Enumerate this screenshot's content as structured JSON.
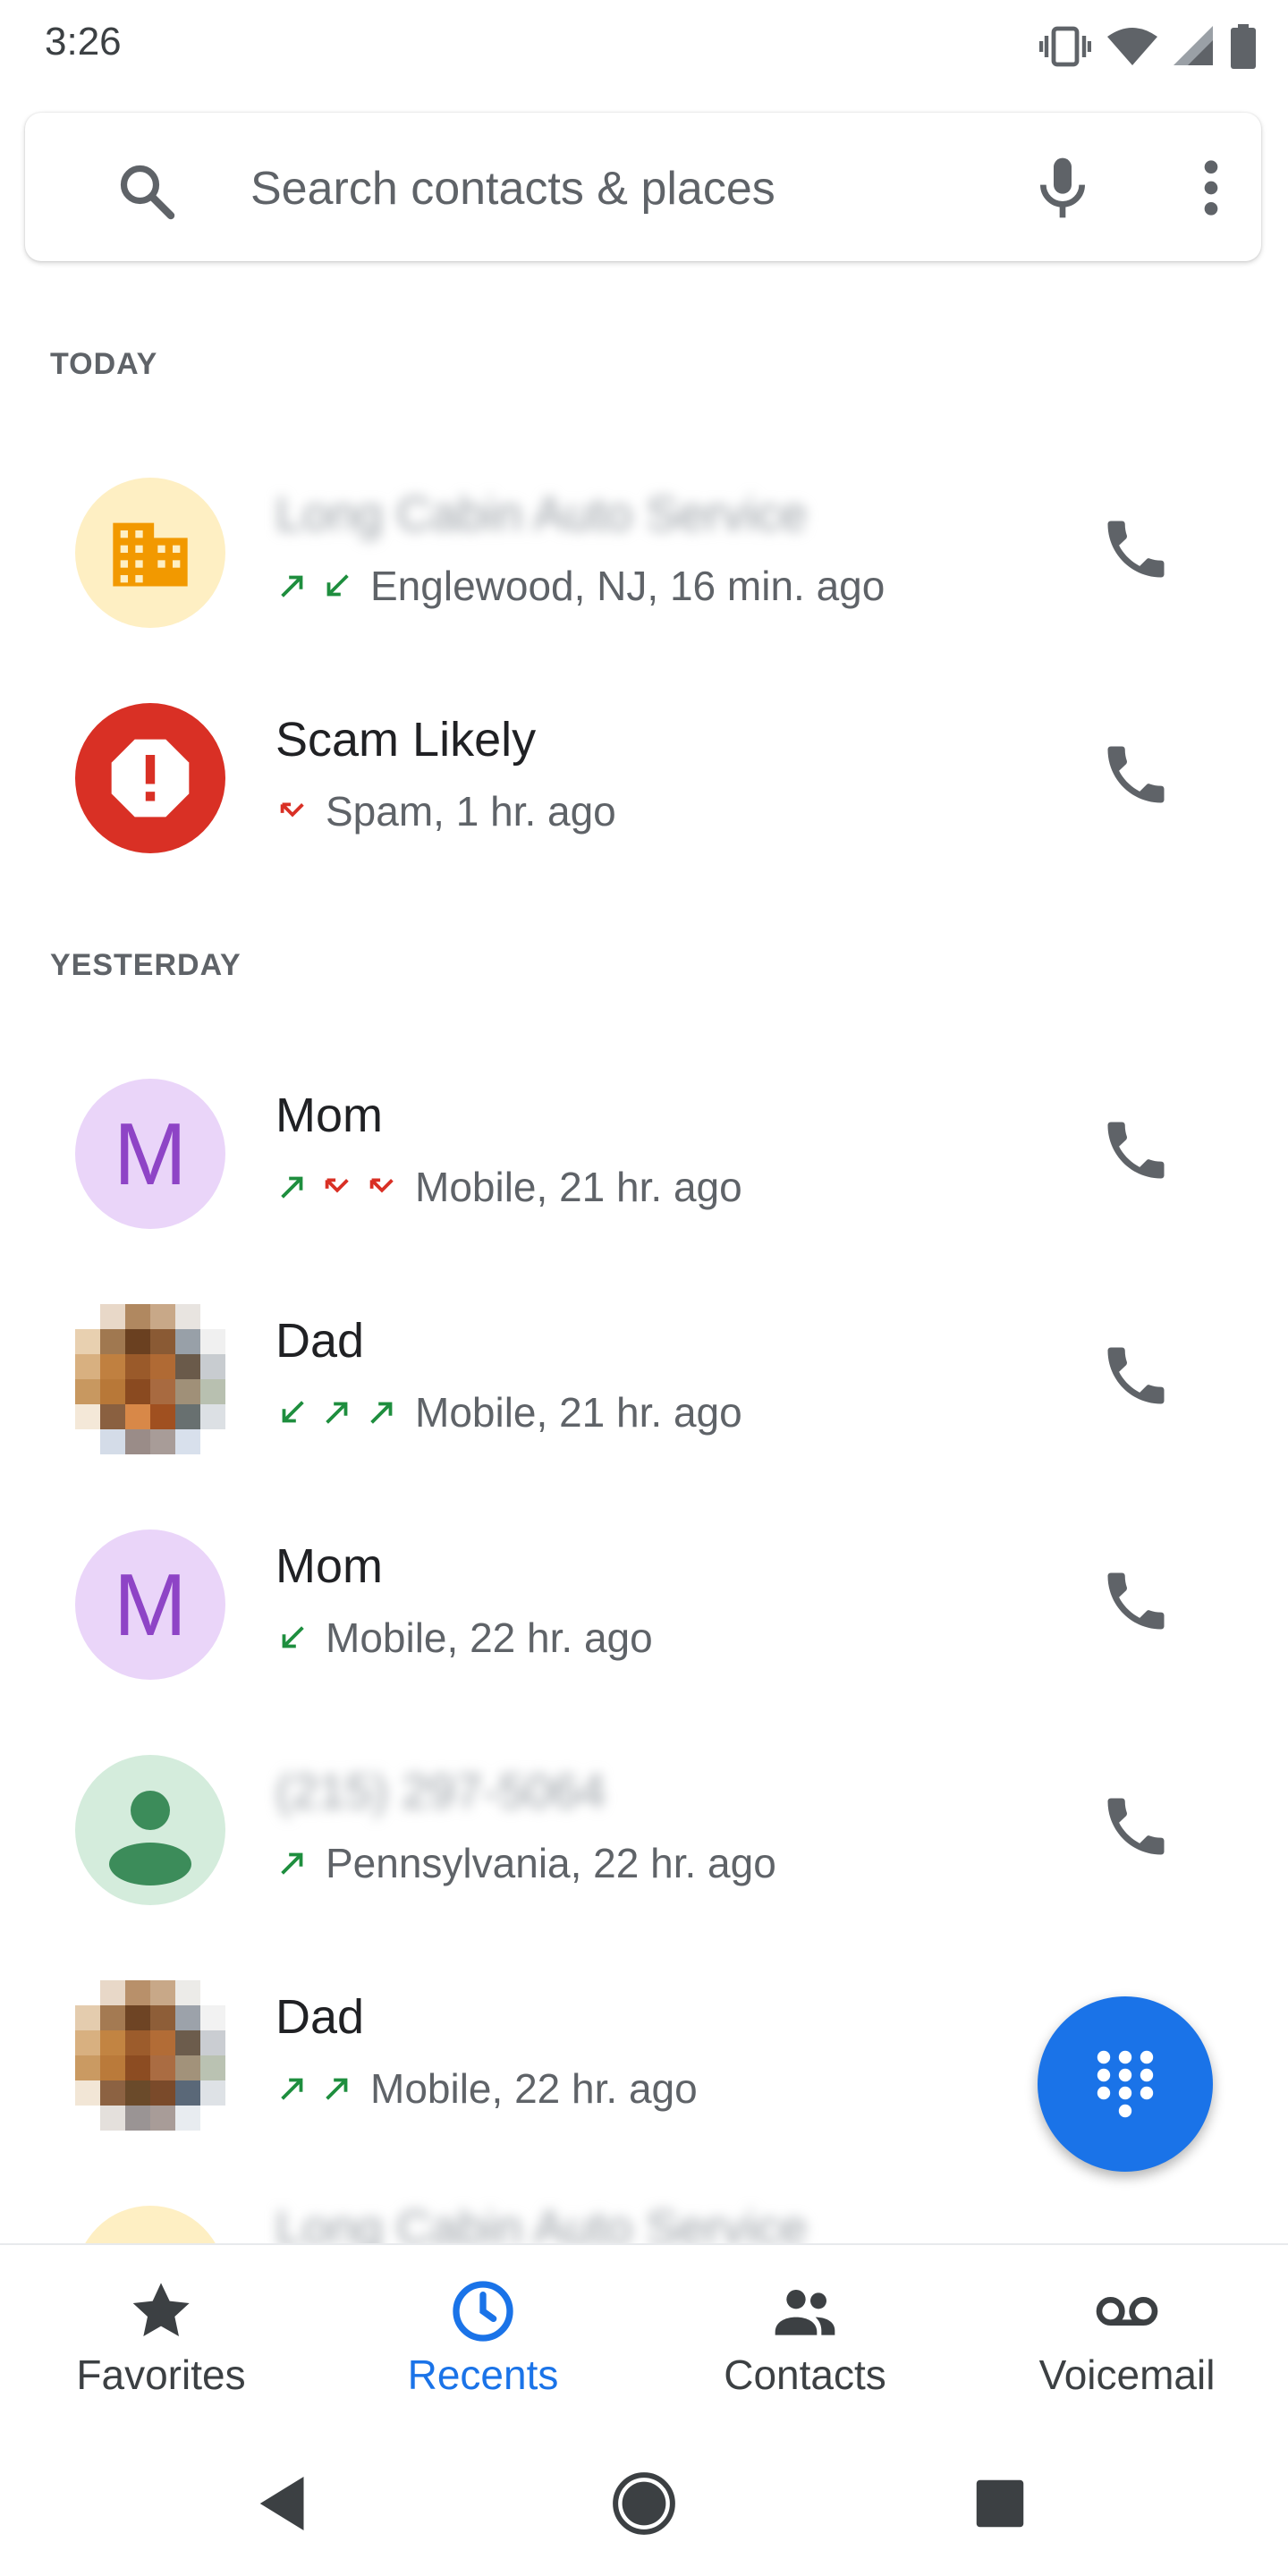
{
  "status": {
    "time": "3:26"
  },
  "search": {
    "placeholder": "Search contacts & places"
  },
  "sections": {
    "today": "TODAY",
    "yesterday": "YESTERDAY"
  },
  "calls": [
    {
      "name": "Long Cabin Auto Service",
      "detail": "Englewood, NJ, 16 min. ago",
      "icon": "business-icon"
    },
    {
      "name": "Scam Likely",
      "detail": "Spam, 1 hr. ago",
      "icon": "spam-icon"
    },
    {
      "name": "Mom",
      "detail": "Mobile, 21 hr. ago",
      "initial": "M"
    },
    {
      "name": "Dad",
      "detail": "Mobile, 21 hr. ago"
    },
    {
      "name": "Mom",
      "detail": "Mobile, 22 hr. ago",
      "initial": "M"
    },
    {
      "name": "(215) 297-5064",
      "detail": "Pennsylvania, 22 hr. ago",
      "icon": "person-icon"
    },
    {
      "name": "Dad",
      "detail": "Mobile, 22 hr. ago"
    },
    {
      "name": "Long Cabin Auto Service"
    }
  ],
  "nav": {
    "favorites": "Favorites",
    "recents": "Recents",
    "contacts": "Contacts",
    "voicemail": "Voicemail"
  },
  "colors": {
    "accent": "#1a73e8",
    "outgoing": "#1e8e3e",
    "missed": "#d93025",
    "spam": "#d93025"
  }
}
